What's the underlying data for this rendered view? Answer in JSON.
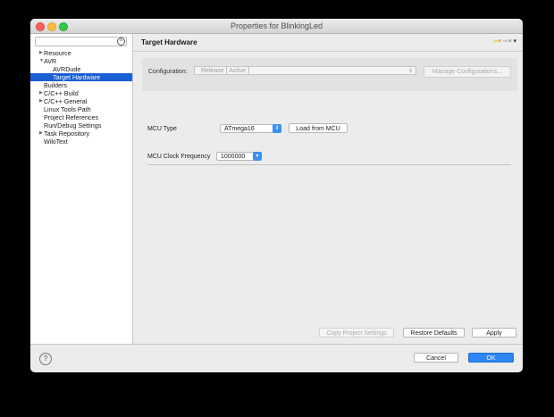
{
  "window": {
    "title": "Properties for BlinkingLed"
  },
  "sidebar": {
    "filter_placeholder": "",
    "items": [
      {
        "label": "Resource",
        "arrow": "▶",
        "level": 1
      },
      {
        "label": "AVR",
        "arrow": "▼",
        "level": 1
      },
      {
        "label": "AVRDude",
        "arrow": "",
        "level": 2
      },
      {
        "label": "Target Hardware",
        "arrow": "",
        "level": 2,
        "selected": true
      },
      {
        "label": "Builders",
        "arrow": "",
        "level": 1
      },
      {
        "label": "C/C++ Build",
        "arrow": "▶",
        "level": 1
      },
      {
        "label": "C/C++ General",
        "arrow": "▶",
        "level": 1
      },
      {
        "label": "Linux Tools Path",
        "arrow": "",
        "level": 1
      },
      {
        "label": "Project References",
        "arrow": "",
        "level": 1
      },
      {
        "label": "Run/Debug Settings",
        "arrow": "",
        "level": 1
      },
      {
        "label": "Task Repository",
        "arrow": "▶",
        "level": 1
      },
      {
        "label": "WikiText",
        "arrow": "",
        "level": 1
      }
    ]
  },
  "page": {
    "title": "Target Hardware",
    "config_label": "Configuration:",
    "config_value": "Release  [ Active ]",
    "manage_label": "Manage Configurations...",
    "mcu_type_label": "MCU Type",
    "mcu_type_value": "ATmega16",
    "load_button": "Load from MCU",
    "clock_label": "MCU Clock Frequency",
    "clock_value": "1000000"
  },
  "footer": {
    "copy_label": "Copy Project Settings",
    "restore_label": "Restore Defaults",
    "apply_label": "Apply",
    "cancel_label": "Cancel",
    "ok_label": "OK",
    "help_glyph": "?"
  },
  "colors": {
    "selection": "#1a5fd4",
    "accent": "#2f86f6"
  }
}
